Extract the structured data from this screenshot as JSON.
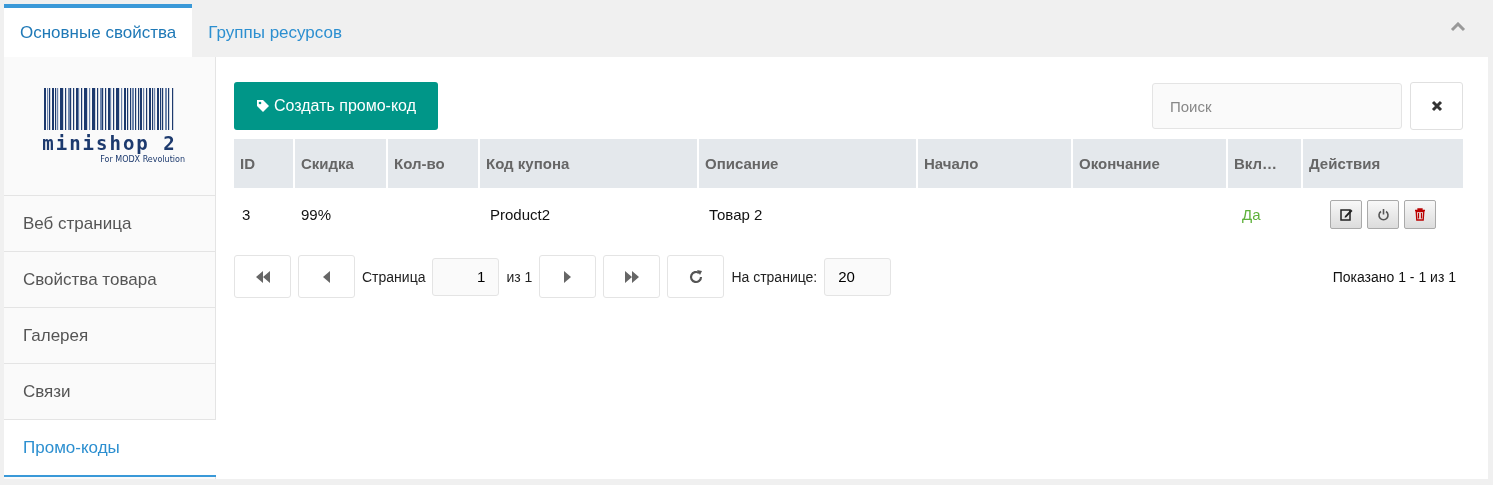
{
  "tabs": [
    {
      "label": "Основные свойства",
      "selected": true
    },
    {
      "label": "Группы ресурсов",
      "selected": false
    }
  ],
  "logo": {
    "title": "minishop 2",
    "subtitle": "For MODX Revolution"
  },
  "sidebar": {
    "items": [
      {
        "label": "Веб страница",
        "selected": false
      },
      {
        "label": "Свойства товара",
        "selected": false
      },
      {
        "label": "Галерея",
        "selected": false
      },
      {
        "label": "Связи",
        "selected": false
      },
      {
        "label": "Промо-коды",
        "selected": true
      }
    ]
  },
  "toolbar": {
    "create_button": "Создать промо-код",
    "search": {
      "placeholder": "Поиск"
    }
  },
  "table": {
    "columns": [
      "ID",
      "Скидка",
      "Кол-во",
      "Код купона",
      "Описание",
      "Начало",
      "Окончание",
      "Вкл…",
      "Действия"
    ],
    "rows": [
      {
        "id": "3",
        "discount": "99%",
        "coupon_code": "Product2",
        "description": "Товар 2",
        "enabled": "Да"
      }
    ]
  },
  "pager": {
    "page_label": "Страница",
    "page": "1",
    "of": "из 1",
    "per_page_label": "На странице:",
    "per_page": "20",
    "summary": "Показано 1 - 1 из 1"
  }
}
